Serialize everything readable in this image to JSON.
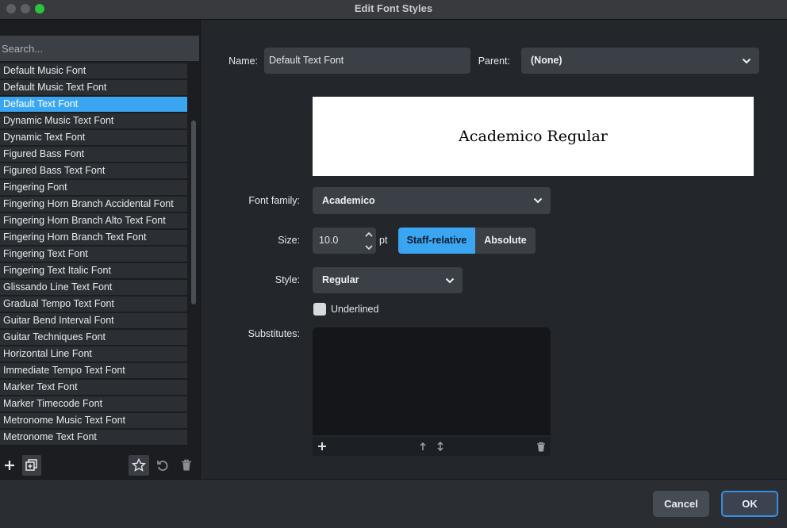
{
  "window": {
    "title": "Edit Font Styles"
  },
  "search": {
    "placeholder": "Search..."
  },
  "font_list": {
    "items": [
      "Default Music Font",
      "Default Music Text Font",
      "Default Text Font",
      "Dynamic Music Text Font",
      "Dynamic Text Font",
      "Figured Bass Font",
      "Figured Bass Text Font",
      "Fingering Font",
      "Fingering Horn Branch Accidental Font",
      "Fingering Horn Branch Alto Text Font",
      "Fingering Horn Branch Text Font",
      "Fingering Text Font",
      "Fingering Text Italic Font",
      "Glissando Line Text Font",
      "Gradual Tempo Text Font",
      "Guitar Bend Interval Font",
      "Guitar Techniques Font",
      "Horizontal Line Font",
      "Immediate Tempo Text Font",
      "Marker Text Font",
      "Marker Timecode Font",
      "Metronome Music Text Font",
      "Metronome Text Font"
    ],
    "selected": "Default Text Font"
  },
  "editor": {
    "name_label": "Name:",
    "name_value": "Default Text Font",
    "parent_label": "Parent:",
    "parent_value": "(None)",
    "preview_text": "Academico Regular",
    "font_family_label": "Font family:",
    "font_family_value": "Academico",
    "size_label": "Size:",
    "size_value": "10.0",
    "size_unit": "pt",
    "staff_relative_label": "Staff-relative",
    "absolute_label": "Absolute",
    "style_label": "Style:",
    "style_value": "Regular",
    "underlined_label": "Underlined",
    "underlined_checked": false,
    "substitutes_label": "Substitutes:"
  },
  "footer": {
    "cancel_label": "Cancel",
    "ok_label": "OK"
  },
  "colors": {
    "accent": "#3aa6f2",
    "panel": "#23272c",
    "field": "#3b4047"
  }
}
